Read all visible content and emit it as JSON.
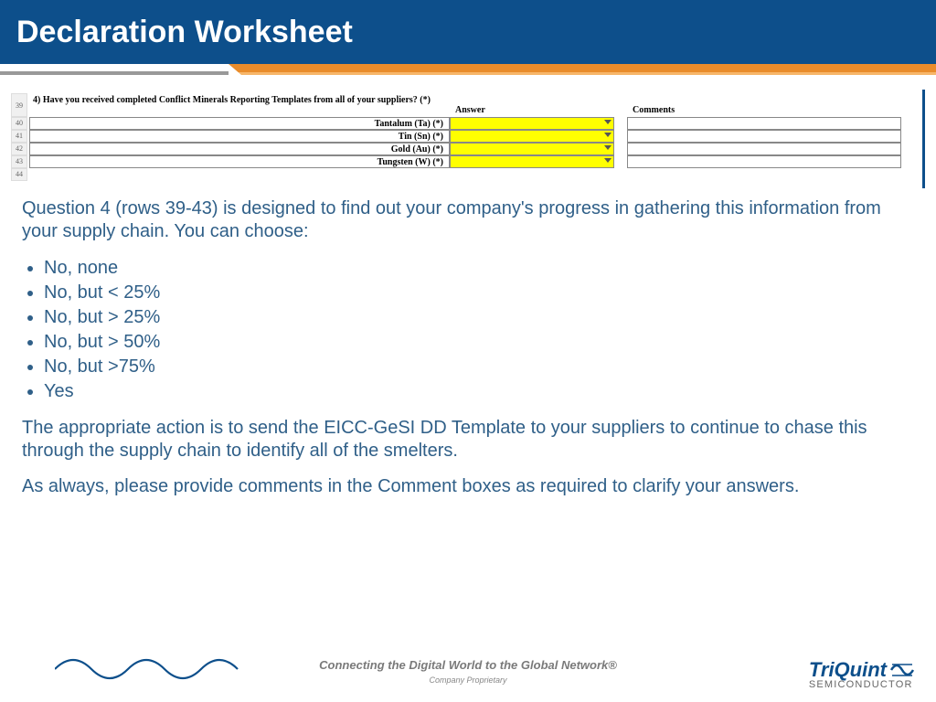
{
  "header": {
    "title": "Declaration Worksheet"
  },
  "sheet": {
    "question": "4) Have you received completed Conflict Minerals Reporting Templates from all of your suppliers? (*)",
    "answer_header": "Answer",
    "comments_header": "Comments",
    "row_numbers": [
      "39",
      "40",
      "41",
      "42",
      "43",
      "44"
    ],
    "metals": [
      "Tantalum (Ta) (*)",
      "Tin (Sn) (*)",
      "Gold (Au) (*)",
      "Tungsten (W) (*)"
    ]
  },
  "explainer": {
    "intro": "Question 4 (rows 39-43) is designed to find out your company's progress in gathering this information from your supply chain.  You can choose:",
    "choices": [
      "No, none",
      "No, but < 25%",
      "No, but > 25%",
      "No, but > 50%",
      "No, but >75%",
      "Yes"
    ],
    "action": "The appropriate action is to send the EICC-GeSI DD Template to your suppliers to continue to chase this through the supply chain to identify all of the smelters.",
    "comments_note": "As always, please provide comments in the Comment boxes as required to clarify your answers."
  },
  "footer": {
    "tagline": "Connecting the Digital World to the Global Network®",
    "proprietary": "Company Proprietary",
    "logo_name": "TriQuint",
    "logo_sub": "SEMICONDUCTOR"
  },
  "colors": {
    "brand_blue": "#0d4f8b",
    "accent_orange": "#e98c2b",
    "highlight": "#ffff00",
    "body_text": "#2f5f88"
  }
}
